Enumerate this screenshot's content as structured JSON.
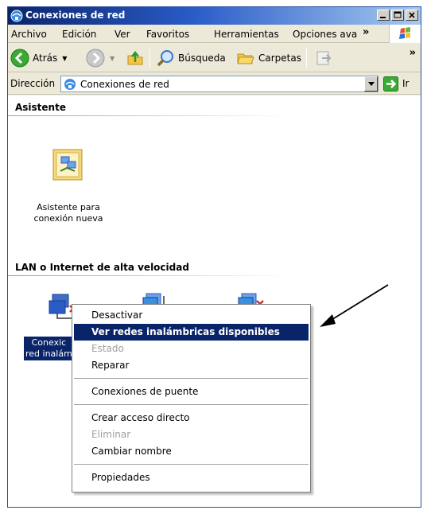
{
  "window": {
    "title": "Conexiones de red",
    "controls": [
      "minimize",
      "maximize",
      "close"
    ]
  },
  "menubar": {
    "items": [
      "Archivo",
      "Edición",
      "Ver",
      "Favoritos",
      "Herramientas",
      "Opciones ava"
    ],
    "overflow": "»"
  },
  "toolbar": {
    "back_label": "Atrás",
    "search_label": "Búsqueda",
    "folders_label": "Carpetas",
    "overflow": "»"
  },
  "address": {
    "label": "Dirección",
    "value": "Conexiones de red",
    "go_label": "Ir"
  },
  "content": {
    "groups": [
      {
        "header": "Asistente",
        "items": [
          {
            "label_line1": "Asistente para",
            "label_line2": "conexión nueva"
          }
        ]
      },
      {
        "header": "LAN o Internet de alta velocidad",
        "items": [
          {
            "label_line1": "Conexic",
            "label_line2": "red inalám",
            "selected": true
          }
        ]
      }
    ]
  },
  "context_menu": {
    "items": [
      {
        "label": "Desactivar",
        "state": "normal"
      },
      {
        "label": "Ver redes inalámbricas disponibles",
        "state": "default-highlighted"
      },
      {
        "label": "Estado",
        "state": "disabled"
      },
      {
        "label": "Reparar",
        "state": "normal"
      },
      {
        "label": "Conexiones de puente",
        "state": "normal"
      },
      {
        "label": "Crear acceso directo",
        "state": "normal"
      },
      {
        "label": "Eliminar",
        "state": "disabled"
      },
      {
        "label": "Cambiar nombre",
        "state": "normal"
      },
      {
        "label": "Propiedades",
        "state": "normal"
      }
    ]
  },
  "colors": {
    "titlebar": "#0a246a",
    "chrome": "#ece9d8",
    "highlight": "#0a246a",
    "disabled_text": "#a0a0a0"
  }
}
